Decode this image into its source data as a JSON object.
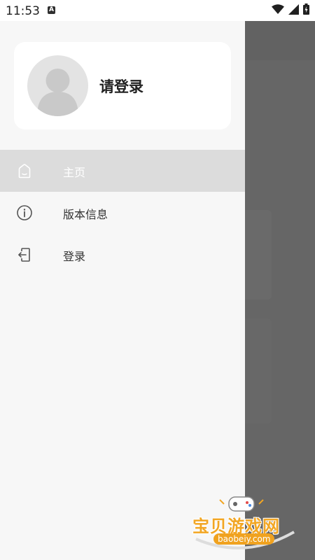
{
  "status_bar": {
    "time": "11:53",
    "notification_icon_letter": "A",
    "icons": [
      "wifi-icon",
      "signal-icon",
      "battery-icon"
    ]
  },
  "drawer": {
    "profile": {
      "login_prompt": "请登录",
      "avatar_icon": "default-avatar-icon"
    },
    "menu": [
      {
        "label": "主页",
        "icon": "home-icon",
        "selected": true
      },
      {
        "label": "版本信息",
        "icon": "info-icon",
        "selected": false
      },
      {
        "label": "登录",
        "icon": "login-icon",
        "selected": false
      }
    ]
  },
  "watermark": {
    "title": "宝贝游戏网",
    "url": "baobeiy.com"
  },
  "colors": {
    "selected_bg": "#dcdcdc",
    "drawer_bg": "#f7f7f7",
    "scrim": "#666666",
    "watermark_accent": "#f2a623"
  }
}
